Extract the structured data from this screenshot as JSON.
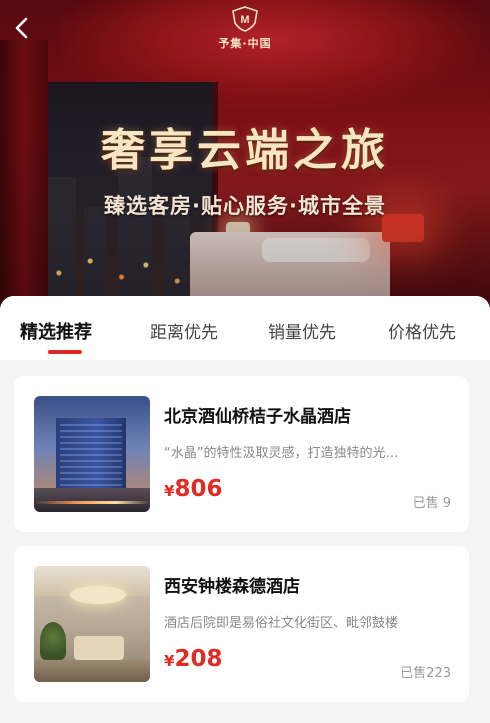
{
  "header": {
    "back_icon": "chevron-left-icon",
    "logo_mark": "M",
    "logo_text": "予集·中国"
  },
  "hero": {
    "headline": "奢享云端之旅",
    "subline": "臻选客房·贴心服务·城市全景"
  },
  "tabs": [
    {
      "label": "精选推荐",
      "active": true
    },
    {
      "label": "距离优先",
      "active": false
    },
    {
      "label": "销量优先",
      "active": false
    },
    {
      "label": "价格优先",
      "active": false
    }
  ],
  "hotels": [
    {
      "name": "北京酒仙桥桔子水晶酒店",
      "description": "“水晶”的特性汲取灵感，打造独特的光…",
      "currency": "¥",
      "price": "806",
      "sold": "已售 9"
    },
    {
      "name": "西安钟楼森德酒店",
      "description": "酒店后院即是易俗社文化街区、毗邻鼓楼",
      "currency": "¥",
      "price": "208",
      "sold": "已售223"
    }
  ],
  "colors": {
    "accent": "#e02a24",
    "hero_dark": "#5a0a10",
    "headline_gold": "#f7e6c2"
  }
}
